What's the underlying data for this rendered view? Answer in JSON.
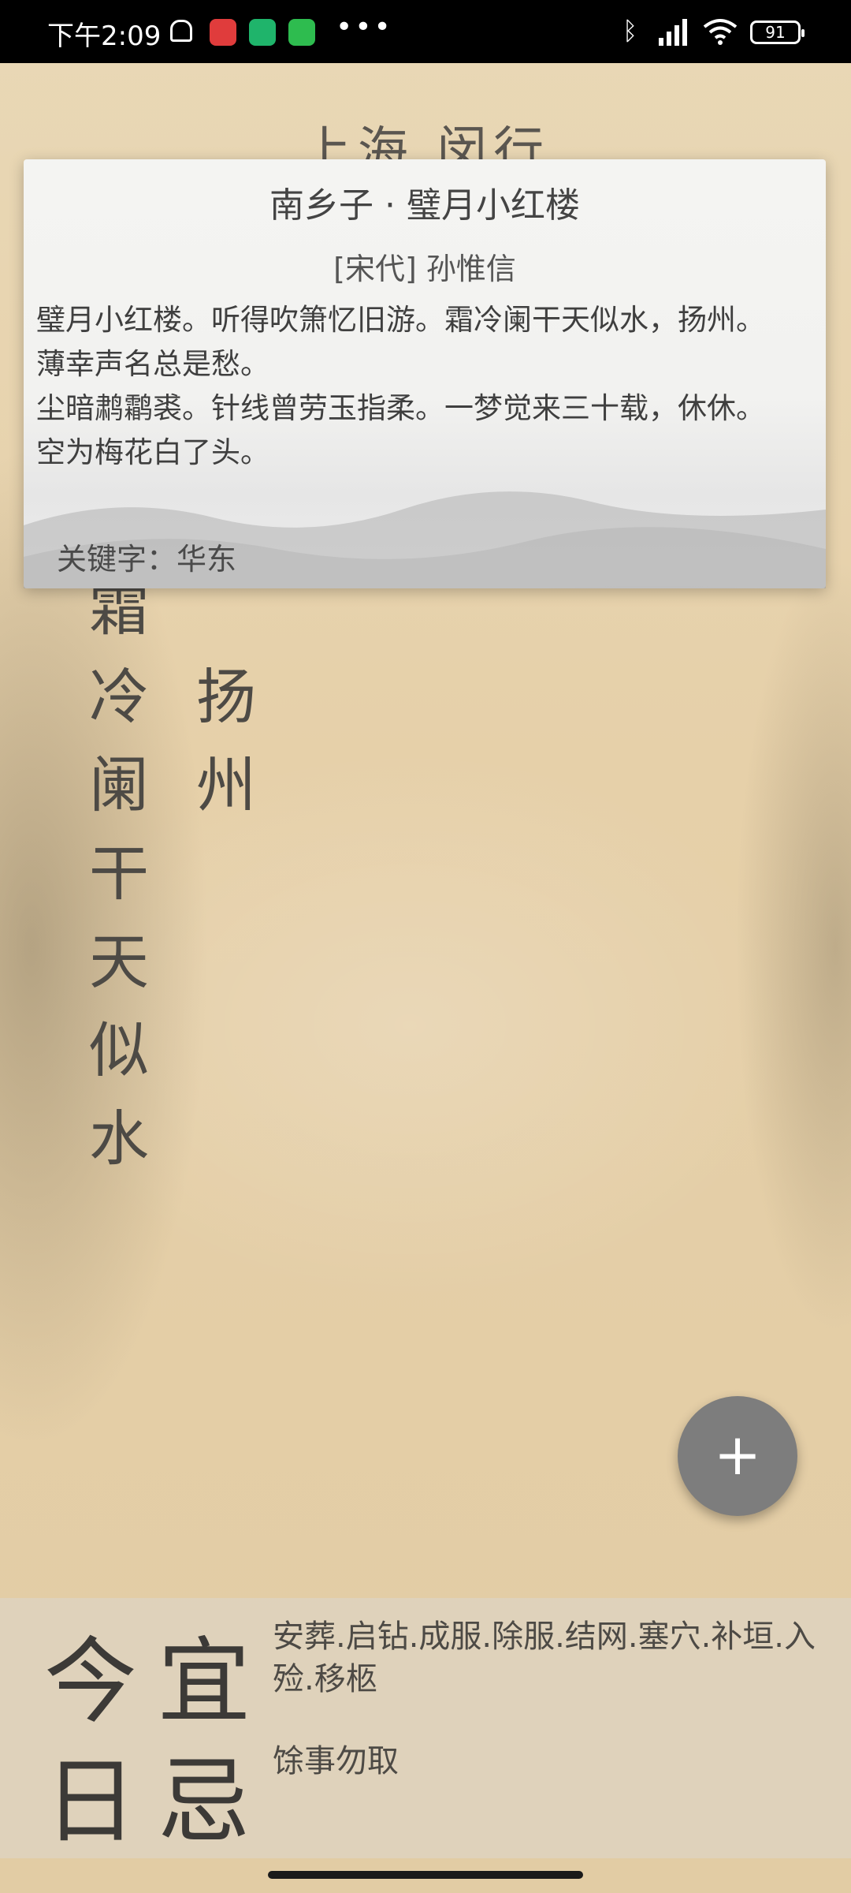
{
  "status_bar": {
    "time": "下午2:09",
    "battery": "91",
    "icons": [
      "bell-off-icon",
      "netease-music-icon",
      "shield-app-icon",
      "wechat-icon",
      "more-icon",
      "bluetooth-icon",
      "signal-icon",
      "wifi-icon",
      "battery-icon"
    ]
  },
  "location": "上海 闵行",
  "poem_vertical": {
    "col1": [
      "霜",
      "冷",
      "阑",
      "干",
      "天",
      "似",
      "水"
    ],
    "col2": [
      "扬",
      "州"
    ]
  },
  "popup": {
    "title": "南乡子 · 璧月小红楼",
    "author": "[宋代] 孙惟信",
    "lines": [
      "璧月小红楼。听得吹箫忆旧游。霜冷阑干天似水，扬州。",
      "薄幸声名总是愁。",
      "尘暗鹔鹴裘。针线曾劳玉指柔。一梦觉来三十载，休休。",
      "空为梅花白了头。"
    ],
    "keyword": "关键字：华东"
  },
  "fab": {
    "label": "+"
  },
  "almanac": {
    "jin": "今",
    "ri": "日",
    "yi": "宜",
    "ji": "忌",
    "yi_items": "安葬.启钻.成服.除服.结网.塞穴.补垣.入殓.移柩",
    "ji_items": "馀事勿取"
  },
  "colors": {
    "paper": "#e6d2ad",
    "fab": "#7d7d7d",
    "text_dark": "#3c3a37"
  }
}
